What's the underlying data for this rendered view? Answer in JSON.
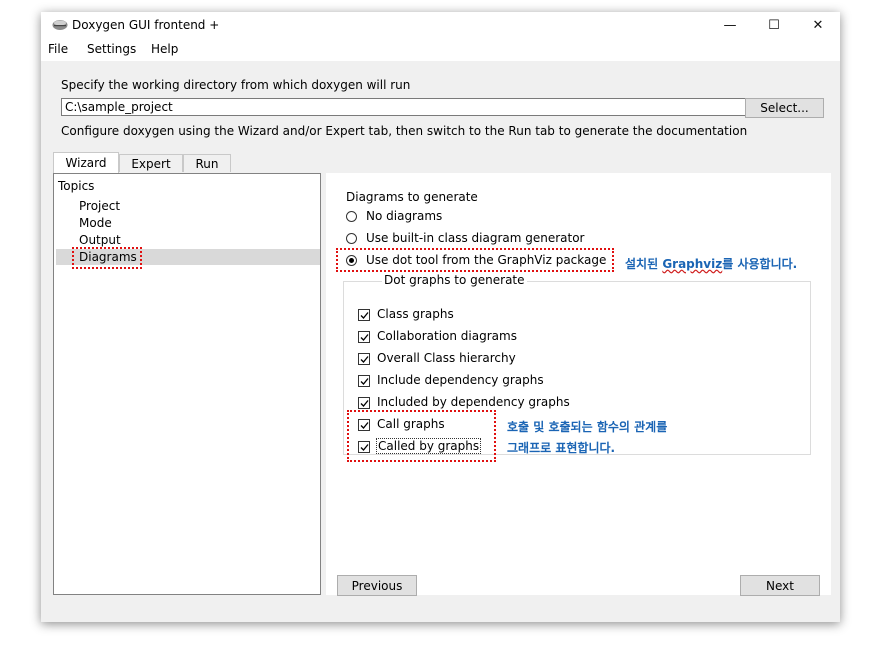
{
  "window": {
    "title": "Doxygen GUI frontend +",
    "controls": {
      "minimize": "—",
      "maximize": "☐",
      "close": "✕"
    }
  },
  "menu": [
    "File",
    "Settings",
    "Help"
  ],
  "workdir": {
    "prompt": "Specify the working directory from which doxygen will run",
    "value": "C:\\sample_project",
    "select_label": "Select..."
  },
  "configure_hint": "Configure doxygen using the Wizard and/or Expert tab, then switch to the Run tab to generate the documentation",
  "tabs": [
    "Wizard",
    "Expert",
    "Run"
  ],
  "active_tab": "Wizard",
  "topics": {
    "header": "Topics",
    "items": [
      "Project",
      "Mode",
      "Output",
      "Diagrams"
    ],
    "selected": "Diagrams"
  },
  "diagrams": {
    "heading": "Diagrams to generate",
    "options": [
      {
        "label": "No diagrams",
        "checked": false
      },
      {
        "label": "Use built-in class diagram generator",
        "checked": false
      },
      {
        "label": "Use dot tool from the GraphViz package",
        "checked": true
      }
    ],
    "dot_group_title": "Dot graphs to generate",
    "dot_graphs": [
      {
        "label": "Class graphs",
        "checked": true
      },
      {
        "label": "Collaboration diagrams",
        "checked": true
      },
      {
        "label": "Overall Class hierarchy",
        "checked": true
      },
      {
        "label": "Include dependency graphs",
        "checked": true
      },
      {
        "label": "Included by dependency graphs",
        "checked": true
      },
      {
        "label": "Call graphs",
        "checked": true
      },
      {
        "label": "Called by graphs",
        "checked": true
      }
    ]
  },
  "nav": {
    "previous": "Previous",
    "next": "Next"
  },
  "annotations": {
    "graphviz_pre": "설치된 ",
    "graphviz_word": "Graphviz",
    "graphviz_post": "를 사용합니다.",
    "callgraph_line1": "호출 및 호출되는 함수의 관계를",
    "callgraph_line2": "그래프로 표현합니다."
  },
  "colors": {
    "annotation": "#1a64b4",
    "highlight_border": "#e01010"
  }
}
